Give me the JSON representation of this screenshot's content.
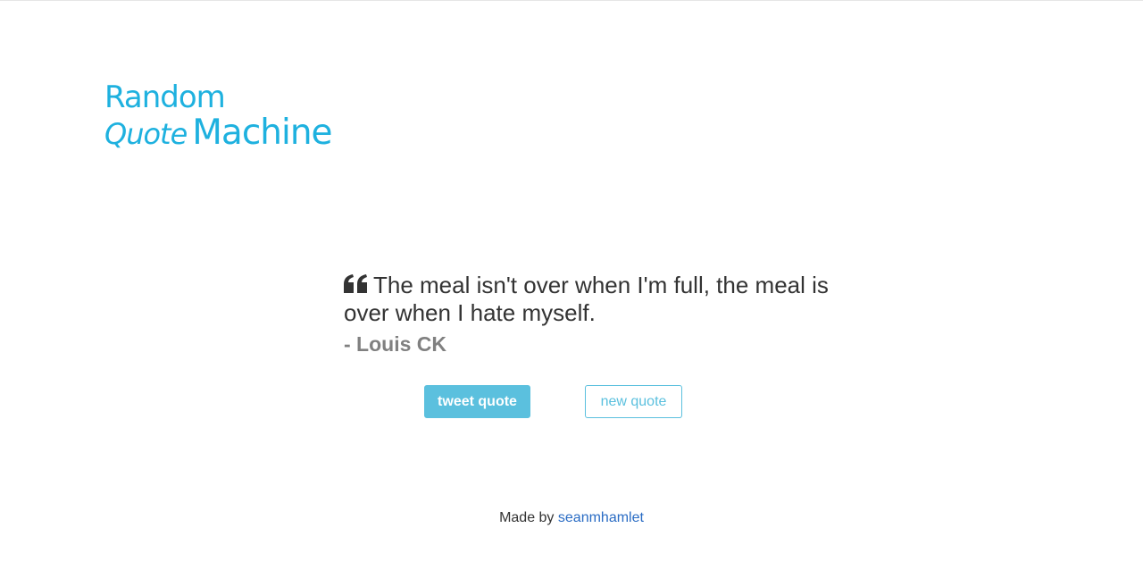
{
  "logo": {
    "line1": "Random",
    "quote_word": "Quote",
    "machine_word": "Machine"
  },
  "quote": {
    "text": "The meal isn't over when I'm full, the meal is over when I hate myself.",
    "author": "- Louis CK",
    "icon": "quote-left-icon"
  },
  "buttons": {
    "tweet_label": "tweet quote",
    "new_label": "new quote"
  },
  "footer": {
    "prefix": "Made by",
    "link_text": "seanmhamlet"
  },
  "colors": {
    "brand": "#1eb1df",
    "accent": "#5bc0de",
    "text": "#333333",
    "author": "#808080",
    "link": "#2a6cc4"
  }
}
